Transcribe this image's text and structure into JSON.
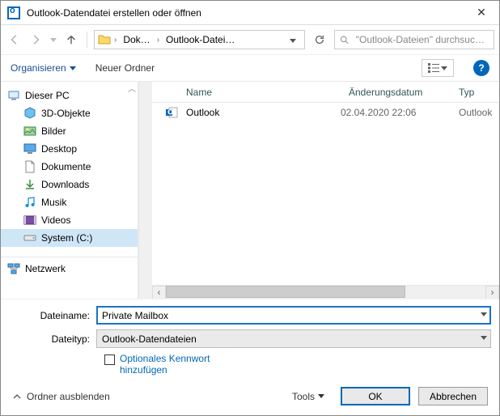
{
  "title": "Outlook-Datendatei erstellen oder öffnen",
  "breadcrumb": {
    "seg1": "Dok…",
    "seg2": "Outlook-Datei…"
  },
  "search": {
    "placeholder": "\"Outlook-Dateien\" durchsuc…"
  },
  "toolbar": {
    "organise": "Organisieren",
    "new_folder": "Neuer Ordner"
  },
  "tree": {
    "this_pc": "Dieser PC",
    "items": [
      "3D-Objekte",
      "Bilder",
      "Desktop",
      "Dokumente",
      "Downloads",
      "Musik",
      "Videos",
      "System (C:)"
    ],
    "network": "Netzwerk"
  },
  "columns": {
    "name": "Name",
    "date": "Änderungsdatum",
    "type": "Typ"
  },
  "files": [
    {
      "name": "Outlook",
      "date": "02.04.2020 22:06",
      "type": "Outlook"
    }
  ],
  "fields": {
    "filename_label": "Dateiname:",
    "filename_value": "Private Mailbox",
    "filetype_label": "Dateityp:",
    "filetype_value": "Outlook-Datendateien",
    "optional_pw": "Optionales Kennwort hinzufügen"
  },
  "footer": {
    "hide_folders": "Ordner ausblenden",
    "tools": "Tools",
    "ok": "OK",
    "cancel": "Abbrechen"
  }
}
